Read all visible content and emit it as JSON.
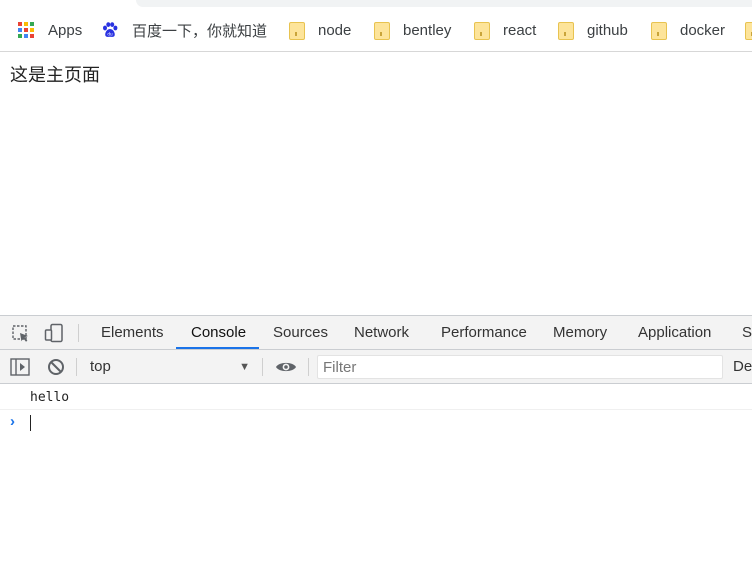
{
  "bookmarks": [
    {
      "name": "apps",
      "label": "Apps",
      "icon": "apps-icon"
    },
    {
      "name": "baidu",
      "label": "百度一下，你就知道",
      "icon": "baidu-paw-icon"
    },
    {
      "name": "node",
      "label": "node",
      "icon": "folder-icon"
    },
    {
      "name": "bentley",
      "label": "bentley",
      "icon": "folder-icon"
    },
    {
      "name": "react",
      "label": "react",
      "icon": "folder-icon"
    },
    {
      "name": "github",
      "label": "github",
      "icon": "folder-icon"
    },
    {
      "name": "docker",
      "label": "docker",
      "icon": "folder-icon"
    }
  ],
  "page": {
    "heading": "这是主页面"
  },
  "devtools": {
    "tabs": [
      "Elements",
      "Console",
      "Sources",
      "Network",
      "Performance",
      "Memory",
      "Application",
      "S"
    ],
    "active_tab": "Console",
    "context": "top",
    "filter_placeholder": "Filter",
    "levels_label": "De"
  },
  "console": {
    "logs": [
      "hello"
    ]
  },
  "colors": {
    "accent": "#1a73e8",
    "folder": "#fde49a",
    "baidu_blue": "#2932e1"
  }
}
